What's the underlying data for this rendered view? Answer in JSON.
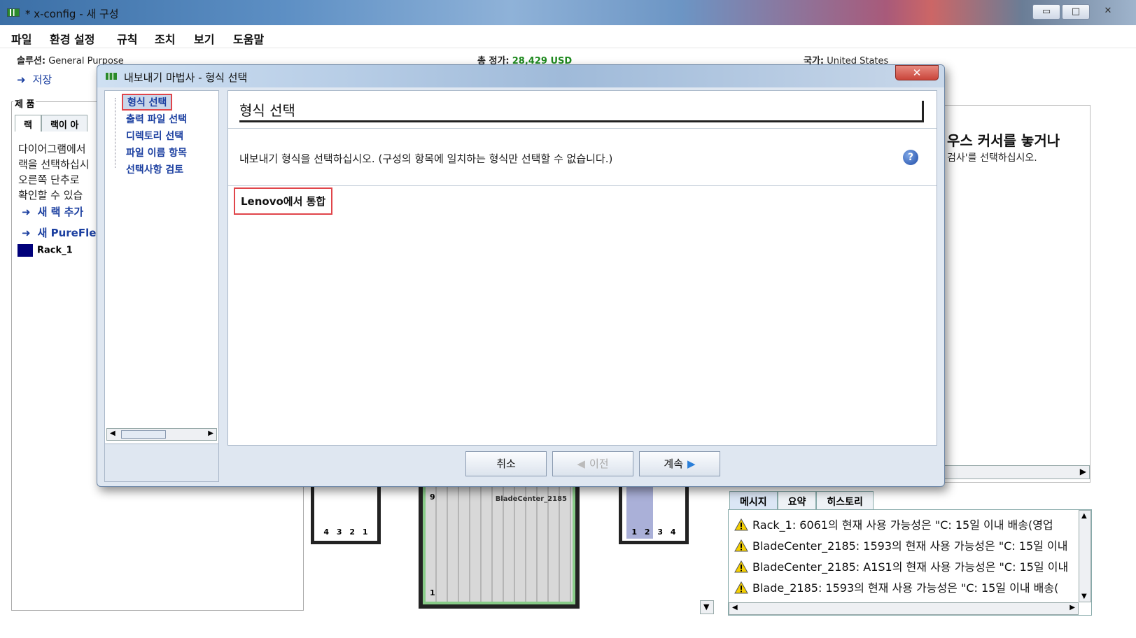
{
  "window": {
    "title": "* x-config - 새 구성",
    "minimize": "▭",
    "maximize": "□",
    "close": "✕"
  },
  "menu": [
    "파일",
    "환경 설정",
    "규칙",
    "조치",
    "보기",
    "도움말"
  ],
  "info": {
    "solution_label": "솔루션:",
    "solution_value": "General Purpose",
    "price_label": "총 정가:",
    "price_value": "28,429 USD",
    "country_label": "국가:",
    "country_value": "United States",
    "save": "저장"
  },
  "products": {
    "legend": "제 품",
    "tabs": [
      "랙",
      "랙이 아"
    ],
    "text_lines": [
      "다이어그램에서",
      "랙을 선택하십시",
      "오른쪽 단추로",
      "확인할 수 있습"
    ],
    "links": [
      "새 랙 추가",
      "새 PureFle"
    ],
    "rack_item": "Rack_1"
  },
  "right_panel": {
    "heading": "우스 커서를 놓거나",
    "sub": "검사'를 선택하십시오."
  },
  "messages": {
    "tabs": [
      "메시지",
      "요약",
      "히스토리"
    ],
    "rows": [
      "Rack_1: 6061의 현재 사용 가능성은 \"C: 15일 이내 배송(영업",
      "BladeCenter_2185: 1593의 현재 사용 가능성은 \"C: 15일 이내",
      "BladeCenter_2185: A1S1의 현재 사용 가능성은 \"C: 15일 이내",
      "Blade_2185: 1593의 현재 사용 가능성은 \"C: 15일 이내 배송("
    ]
  },
  "diagram": {
    "left_slots": [
      "4",
      "3",
      "2",
      "1"
    ],
    "right_slots": [
      "1",
      "2",
      "3",
      "4"
    ],
    "blade_title": "BladeCenter_2185",
    "blade_top": "9",
    "blade_bottom": "1"
  },
  "dialog": {
    "title": "내보내기 마법사 - 형식 선택",
    "nav": [
      "형식 선택",
      "출력 파일 선택",
      "디렉토리 선택",
      "파일 이름 항목",
      "선택사항 검토"
    ],
    "heading": "형식 선택",
    "instruction": "내보내기 형식을 선택하십시오. (구성의 항목에 일치하는 형식만 선택할 수 없습니다.)",
    "help": "?",
    "option": "Lenovo에서 통합",
    "buttons": {
      "cancel": "취소",
      "prev": "이전",
      "next": "계속"
    }
  },
  "colors": {
    "price": "#1f8a1f",
    "link": "#1b3fa0",
    "highlight": "#e0454a"
  }
}
